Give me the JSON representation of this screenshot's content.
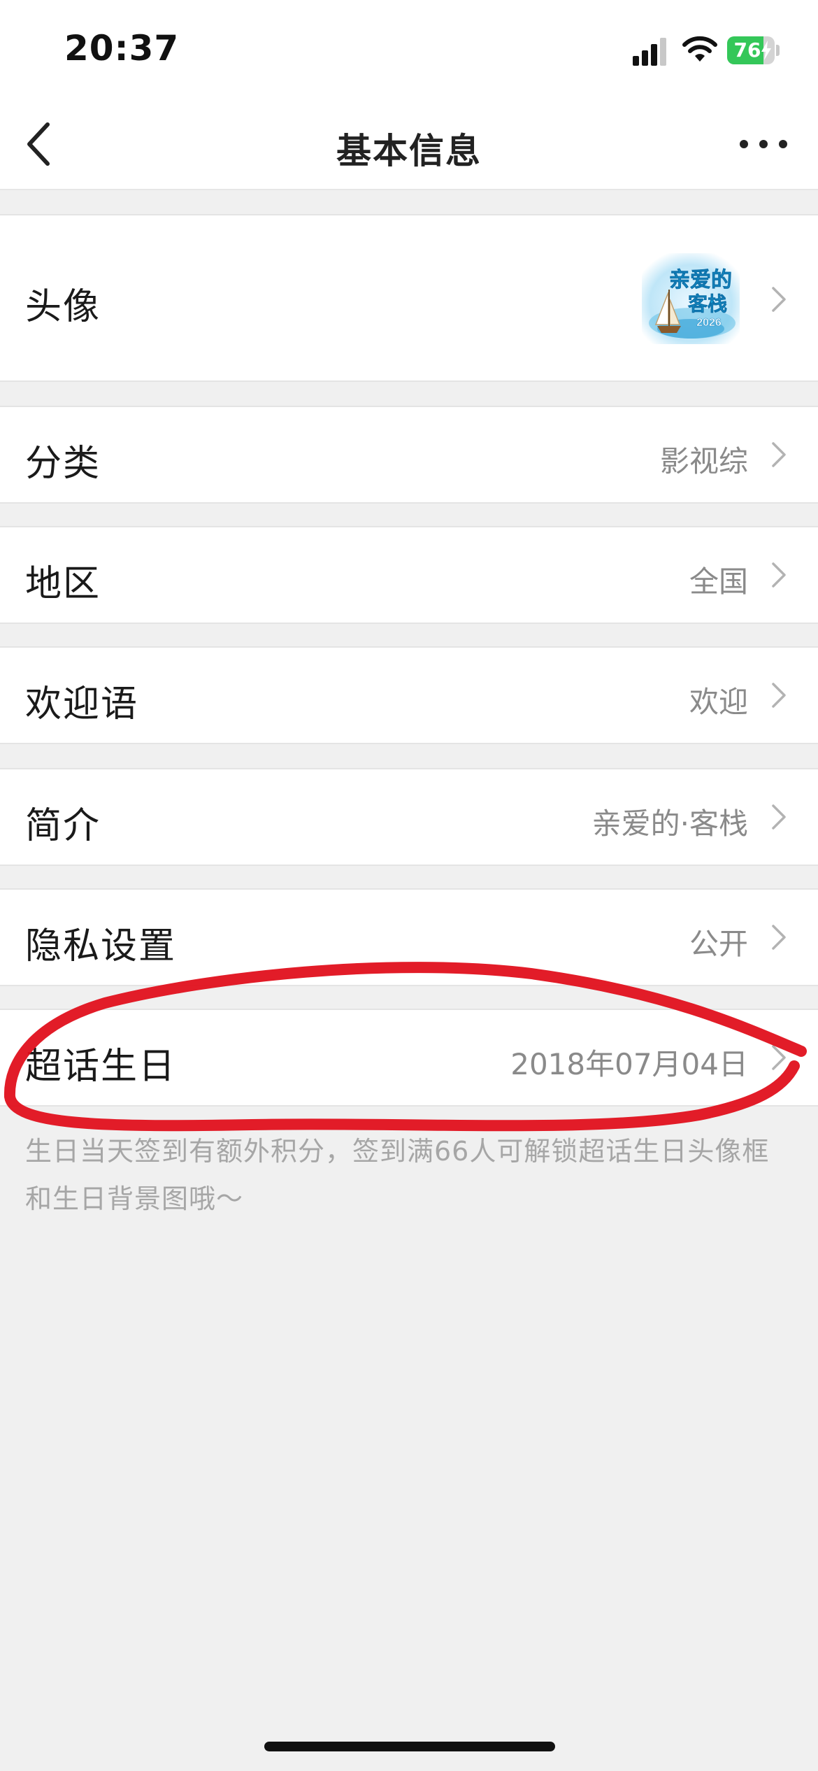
{
  "status_bar": {
    "time": "20:37",
    "battery_level": "76",
    "battery_fraction": 0.76,
    "icons": [
      "signal-icon",
      "wifi-icon",
      "battery-icon",
      "charging-bolt-icon"
    ]
  },
  "nav": {
    "title": "基本信息",
    "back_icon": "chevron-left-icon",
    "more_icon": "more-dots-icon"
  },
  "rows": {
    "avatar": {
      "label": "头像",
      "image_text": "亲爱的客栈",
      "image_year": "2026"
    },
    "category": {
      "label": "分类",
      "value": "影视综"
    },
    "region": {
      "label": "地区",
      "value": "全国"
    },
    "welcome": {
      "label": "欢迎语",
      "value": "欢迎"
    },
    "intro": {
      "label": "简介",
      "value": "亲爱的·客栈"
    },
    "privacy": {
      "label": "隐私设置",
      "value": "公开"
    },
    "birthday": {
      "label": "超话生日",
      "value": "2018年07月04日"
    }
  },
  "footnote": "生日当天签到有额外积分，签到满66人可解锁超话生日头像框和生日背景图哦～",
  "colors": {
    "background": "#f0f0f0",
    "row_background": "#ffffff",
    "value_text": "#8a8a8a",
    "annotation_red": "#e0101c",
    "battery_green": "#34c759"
  }
}
